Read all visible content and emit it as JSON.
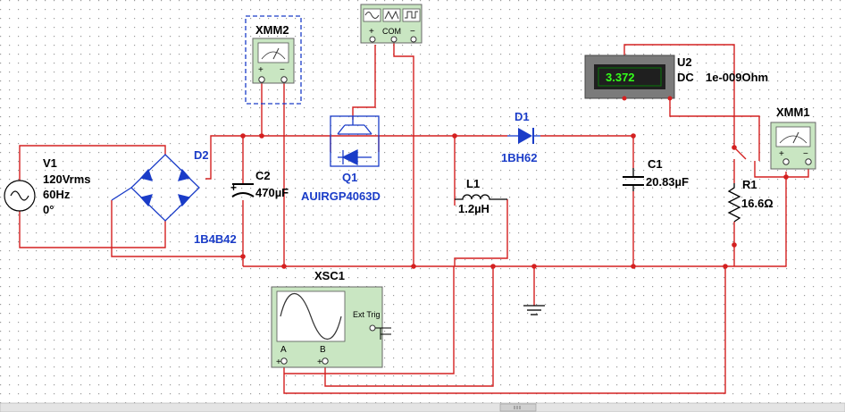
{
  "components": {
    "v1": {
      "ref": "V1",
      "voltage": "120Vrms",
      "freq": "60Hz",
      "phase": "0°"
    },
    "d2": {
      "ref": "D2",
      "model": "1B4B42"
    },
    "c2": {
      "ref": "C2",
      "value": "470µF"
    },
    "q1": {
      "ref": "Q1",
      "model": "AUIRGP4063D"
    },
    "d1": {
      "ref": "D1",
      "model": "1BH62"
    },
    "l1": {
      "ref": "L1",
      "value": "1.2µH"
    },
    "c1": {
      "ref": "C1",
      "value": "20.83µF"
    },
    "r1": {
      "ref": "R1",
      "value": "16.6Ω"
    },
    "u2": {
      "ref": "U2",
      "mode": "DC",
      "resistance": "1e-009Ohm",
      "reading": "3.372"
    },
    "xmm1": {
      "ref": "XMM1"
    },
    "xmm2": {
      "ref": "XMM2"
    },
    "xsc1": {
      "ref": "XSC1",
      "ch_a": "A",
      "ch_b": "B",
      "ext_trig": "Ext Trig"
    },
    "xfg": {
      "com": "COM",
      "plus": "+",
      "minus": "−"
    }
  },
  "meter_terminals": {
    "plus": "+",
    "minus": "−"
  },
  "colors": {
    "wire": "#d42020",
    "component": "#1a3cc8",
    "instrument_bg": "#c9e6c2",
    "display_bg": "#1f1f1f",
    "display_text": "#34ff1a"
  }
}
